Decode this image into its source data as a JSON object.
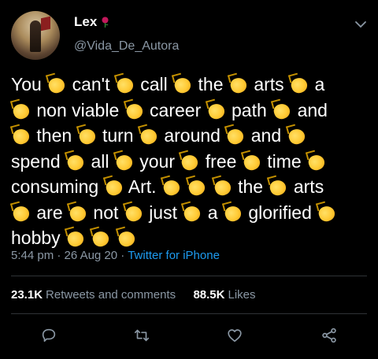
{
  "user": {
    "display_name": "Lex",
    "handle": "@Vida_De_Autora"
  },
  "tweet": {
    "lines": [
      [
        "You",
        "clap",
        "can't",
        "clap",
        "call",
        "clap",
        "the",
        "clap",
        "arts",
        "clap",
        "a"
      ],
      [
        "clap",
        "non viable",
        "clap",
        "career",
        "clap",
        "path",
        "clap",
        "and"
      ],
      [
        "clap",
        "then",
        "clap",
        "turn",
        "clap",
        "around",
        "clap",
        "and",
        "clap"
      ],
      [
        "spend",
        "clap",
        "all",
        "clap",
        "your",
        "clap",
        "free",
        "clap",
        "time",
        "clap"
      ],
      [
        "consuming",
        "clap",
        "Art.",
        "clap",
        "clap",
        "clap",
        "the",
        "clap",
        "arts"
      ],
      [
        "clap",
        "are",
        "clap",
        "not",
        "clap",
        "just",
        "clap",
        "a",
        "clap",
        "glorified",
        "clap"
      ],
      [
        "hobby",
        "clap",
        "clap",
        "clap"
      ]
    ]
  },
  "meta": {
    "time": "5:44 pm",
    "separator": "·",
    "date": "26 Aug 20",
    "source": "Twitter for iPhone"
  },
  "stats": {
    "retweets_count": "23.1K",
    "retweets_label": "Retweets and comments",
    "likes_count": "88.5K",
    "likes_label": "Likes"
  },
  "icons": {
    "rose": "rose-icon",
    "clap": "clapping-hands-icon",
    "chevron": "chevron-down-icon",
    "reply": "reply-icon",
    "retweet": "retweet-icon",
    "like": "heart-icon",
    "share": "share-icon"
  },
  "colors": {
    "background": "#000000",
    "text": "#ffffff",
    "muted": "#8b98a5",
    "link": "#1d9bf0",
    "clap": "#ffc933"
  }
}
